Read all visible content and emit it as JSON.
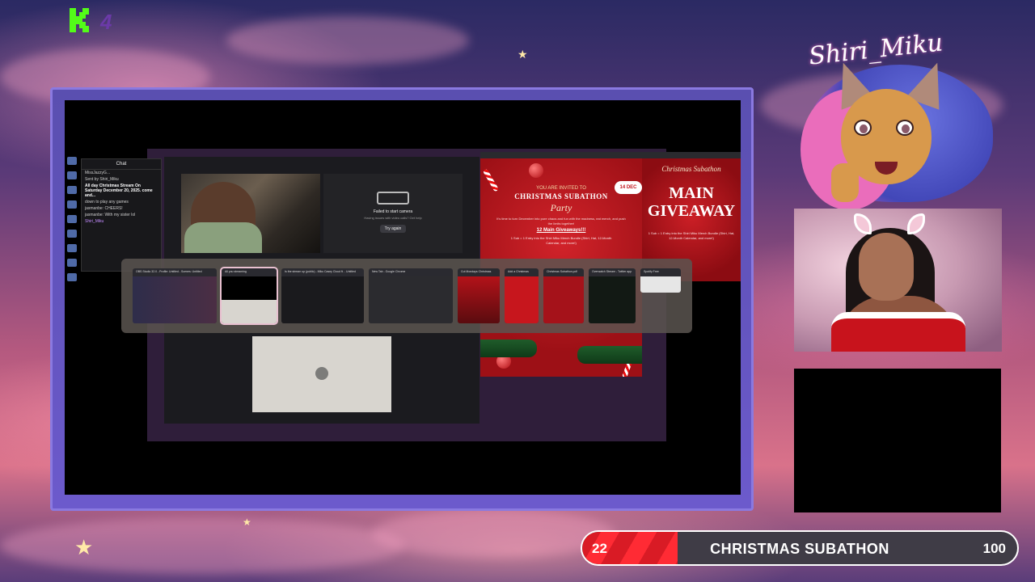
{
  "overlay": {
    "logo_mark": "K",
    "logo_number": "4",
    "streamer_name": "Shiri_Miku",
    "accent_color": "#8a79e0"
  },
  "chat": {
    "title": "Chat",
    "lines": [
      "MissJazzyG...",
      "Sent by Shiri_Miku",
      "All day Christmas Stream On Saturday December 20, 2025. come and...",
      "down to play any games",
      "jasmanbe: CHEERS!",
      "jasmanbe: With my sister lol",
      "Shiri_Miku"
    ]
  },
  "camera_panel": {
    "message": "Failed to start camera",
    "detail": "Having issues with video calls? Get help",
    "retry_button": "Try again"
  },
  "promo_left": {
    "invite": "YOU ARE INVITED TO",
    "title": "CHRISTMAS SUBATHON",
    "script": "Party",
    "date": "14 DEC",
    "giveaway_header": "12 Main Giveaways!!!",
    "body": "It's time to turn December into pure chaos and fun with the madness, eat merch, and push the limits together!",
    "sub": "1 Sub = 1 Entry into the Shiri Miku Merch Bundle (Shirt, Hat, 12-Month Calendar, and more!)"
  },
  "promo_right": {
    "script": "Christmas Subathon",
    "main": "MAIN GIVEAWAY",
    "sub": "1 Sub = 1 Entry into the Shiri Miku Merch Bundle (Shirt, Hat, 12-Month Calendar, and more!)"
  },
  "task_switcher": {
    "windows": [
      "OBS Studio 32.0 - Profile: Untitled - Scenes: Untitled",
      "All you streaming",
      "Is the stream up (public) - Miku Casey Cloud ft. - Untitled",
      "New Tab - Google Chrome",
      "Cut Mondays Christmas",
      "Add a Christmas",
      "Christmas Subathon.pdf",
      "Overwatch Stream - Twitter app",
      "Spotify Free"
    ]
  },
  "subathon": {
    "current": "22",
    "title": "CHRISTMAS SUBATHON",
    "goal": "100",
    "progress_fraction": 0.22,
    "bar_color": "#d91b25"
  }
}
